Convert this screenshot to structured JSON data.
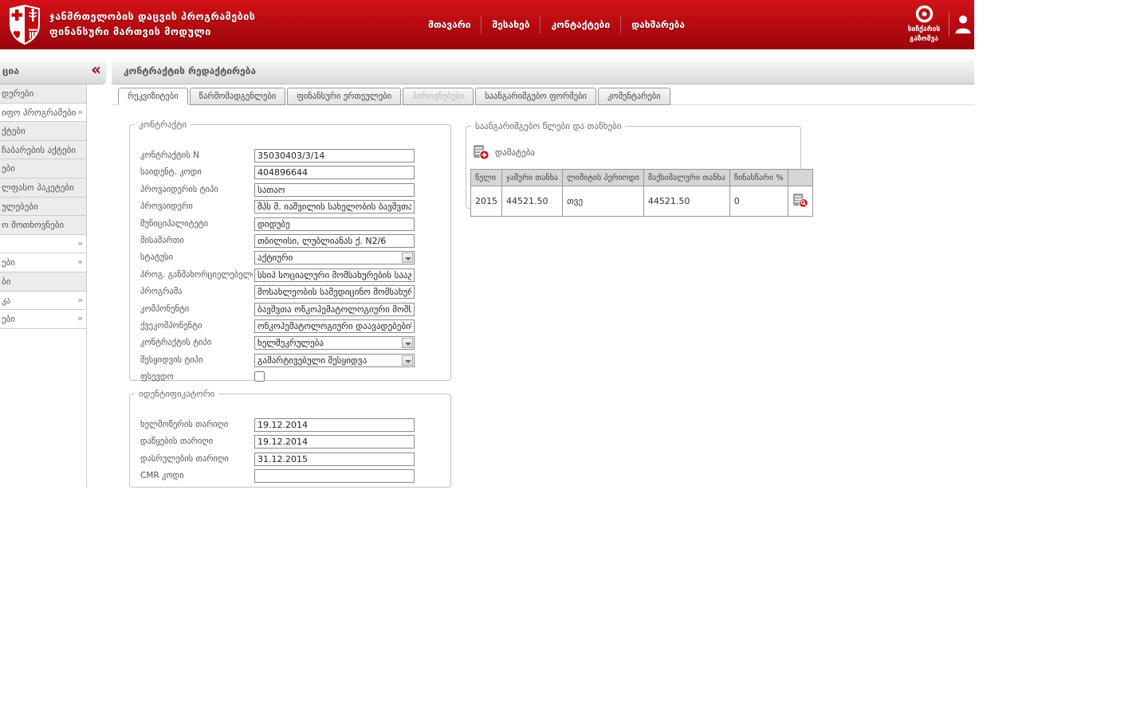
{
  "colors": {
    "brand_red": "#c00a0f",
    "bar_gray": "#dadada",
    "table_header_gray": "#d6d6d6"
  },
  "header": {
    "title_line1": "ჯანმრთელობის დაცვის პროგრამების",
    "title_line2": "ფინანსური მართვის მოდული",
    "nav": [
      {
        "label": "მთავარი"
      },
      {
        "label": "შესახებ"
      },
      {
        "label": "კონტაქტები"
      },
      {
        "label": "დახმარება"
      }
    ],
    "speed_test": {
      "line1": "სიჩქარის",
      "line2": "გაზომვა"
    }
  },
  "sidebar": {
    "header_fragment": "ცია",
    "collapse_glyph": "«",
    "arrow_glyph": "»",
    "items": [
      {
        "text": "დერები",
        "arrow": false,
        "white": false
      },
      {
        "text": "იფო პროგრამები",
        "arrow": true,
        "white": true
      },
      {
        "text": "ქტები",
        "arrow": false,
        "white": false
      },
      {
        "text": "ჩაბარების აქტები",
        "arrow": false,
        "white": false
      },
      {
        "text": "ები",
        "arrow": false,
        "white": false
      },
      {
        "text": "ლფასო პაკეტები",
        "arrow": false,
        "white": false
      },
      {
        "text": "ულებები",
        "arrow": false,
        "white": false
      },
      {
        "text": "ო მოთხოვნები",
        "arrow": false,
        "white": false
      },
      {
        "text": "",
        "arrow": true,
        "white": true
      },
      {
        "text": "ები",
        "arrow": true,
        "white": true
      },
      {
        "text": "ბი",
        "arrow": false,
        "white": false
      },
      {
        "text": "კა",
        "arrow": true,
        "white": true
      },
      {
        "text": "ები",
        "arrow": true,
        "white": true
      }
    ]
  },
  "main": {
    "page_title": "კონტრაქტის რედაქტირება",
    "tabs": [
      {
        "label": "რეკვიზიტები",
        "state": "active"
      },
      {
        "label": "წარმომადგენლები",
        "state": "normal"
      },
      {
        "label": "ფინანსური ერთეულები",
        "state": "normal"
      },
      {
        "label": "პიროვნებები",
        "state": "disabled"
      },
      {
        "label": "საანგარიშგებო ფორმები",
        "state": "normal"
      },
      {
        "label": "კომენტარები",
        "state": "normal"
      }
    ],
    "contract": {
      "legend": "კონტრაქტი",
      "fields": [
        {
          "key": "contract-number",
          "label": "კონტრაქტის N",
          "type": "text",
          "value": "35030403/3/14"
        },
        {
          "key": "ident-code",
          "label": "საიდენტ. კოდი",
          "type": "text",
          "value": "404896644"
        },
        {
          "key": "provider-type",
          "label": "პროვაიდერის ტიპი",
          "type": "text",
          "value": "სათაო"
        },
        {
          "key": "provider",
          "label": "პროვაიდერი",
          "type": "text",
          "value": "შპს მ. იაშვილის სახელობის ბავშვთა ცენტრ"
        },
        {
          "key": "municipality",
          "label": "მუნიციპალიტეტი",
          "type": "text",
          "value": "დიდუბე"
        },
        {
          "key": "address",
          "label": "მისამართი",
          "type": "text",
          "value": "თბილისი, ლუბლიანას ქ. N2/6"
        },
        {
          "key": "status",
          "label": "სტატუსი",
          "type": "select",
          "value": "აქტიური"
        },
        {
          "key": "program-implementer",
          "label": "პროგ. განმახორციელებელი",
          "type": "text",
          "value": "სსიპ სოციალური მომსახურების სააგენტო"
        },
        {
          "key": "program",
          "label": "პროგრამა",
          "type": "text",
          "value": "მოსახლეობის სამედიცინო მომსახურების"
        },
        {
          "key": "component",
          "label": "კომპონენტი",
          "type": "text",
          "value": "ბავშვთა ონკოჰემატოლოგიური მომსახურ"
        },
        {
          "key": "subcomponent",
          "label": "ქვეკომპონენტი",
          "type": "text",
          "value": "ონკოჰემატოლოგიური დაავადებების მქო"
        },
        {
          "key": "contract-type",
          "label": "კონტრაქტის ტიპი",
          "type": "select",
          "value": "ხელშეკრულება"
        },
        {
          "key": "procurement-type",
          "label": "შესყიდვის ტიპი",
          "type": "select",
          "value": "გამარტივებული შესყიდვა"
        },
        {
          "key": "pseudo",
          "label": "ფსევდო",
          "type": "checkbox",
          "value": false
        }
      ]
    },
    "identifier": {
      "legend": "იდენტიფიკატორი",
      "fields": [
        {
          "key": "signing-date",
          "label": "ხელმოწერის თარიღი",
          "type": "text",
          "value": "19.12.2014"
        },
        {
          "key": "start-date",
          "label": "დაწყების თარიღი",
          "type": "text",
          "value": "19.12.2014"
        },
        {
          "key": "end-date",
          "label": "დასრულების თარიღი",
          "type": "text",
          "value": "31.12.2015"
        },
        {
          "key": "cmr-code",
          "label": "CMR კოდი",
          "type": "text",
          "value": ""
        }
      ]
    },
    "years": {
      "legend": "საანგარიშგებო წლები და თანხები",
      "add_label": "დამატება",
      "table": {
        "headers": [
          "წელი",
          "ჯამური თანხა",
          "ლიმიტის პერიოდი",
          "მაქსიმალური თანხა",
          "წინასწარი %",
          ""
        ],
        "col_keys": [
          "year",
          "total-amount",
          "limit-period",
          "max-amount",
          "advance-percent",
          "actions"
        ],
        "rows": [
          {
            "year": "2015",
            "total_amount": "44521.50",
            "limit_period": "თვე",
            "max_amount": "44521.50",
            "advance_percent": "0"
          }
        ]
      }
    }
  }
}
